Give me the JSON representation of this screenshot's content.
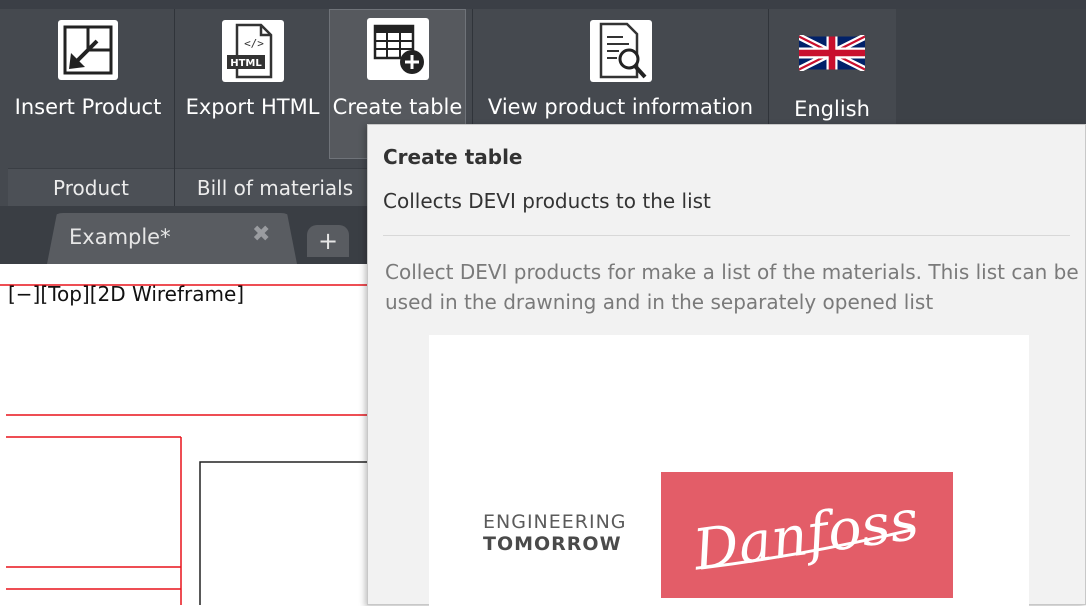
{
  "ribbon": {
    "buttons": [
      {
        "label": "Insert Product",
        "icon": "insert-product-icon"
      },
      {
        "label": "Export HTML",
        "icon": "export-html-icon",
        "icon_text": "HTML"
      },
      {
        "label": "Create table",
        "icon": "create-table-icon",
        "active": true
      },
      {
        "label": "View product information",
        "icon": "view-product-info-icon"
      },
      {
        "label": "English",
        "icon": "uk-flag-icon"
      }
    ],
    "panels": [
      {
        "title": "Product"
      },
      {
        "title": "Bill of materials"
      }
    ]
  },
  "tabs": {
    "document_tab": "Example*",
    "close_glyph": "✖",
    "add_glyph": "+"
  },
  "viewport": {
    "label": "[−][Top][2D Wireframe]"
  },
  "tooltip": {
    "title": "Create table",
    "subtitle": "Collects DEVI products to the list",
    "description": "Collect DEVI products for make a list of the materials. This list can be used in the drawning and in the separately opened list",
    "image": {
      "tagline_line1": "ENGINEERING",
      "tagline_line2": "TOMORROW",
      "brand": "Danfoss",
      "brand_color": "#e35d68"
    }
  },
  "colors": {
    "ribbon_bg": "#45494f",
    "tab_bar_bg": "#3a3e44",
    "drawing_line": "#e8141b"
  }
}
